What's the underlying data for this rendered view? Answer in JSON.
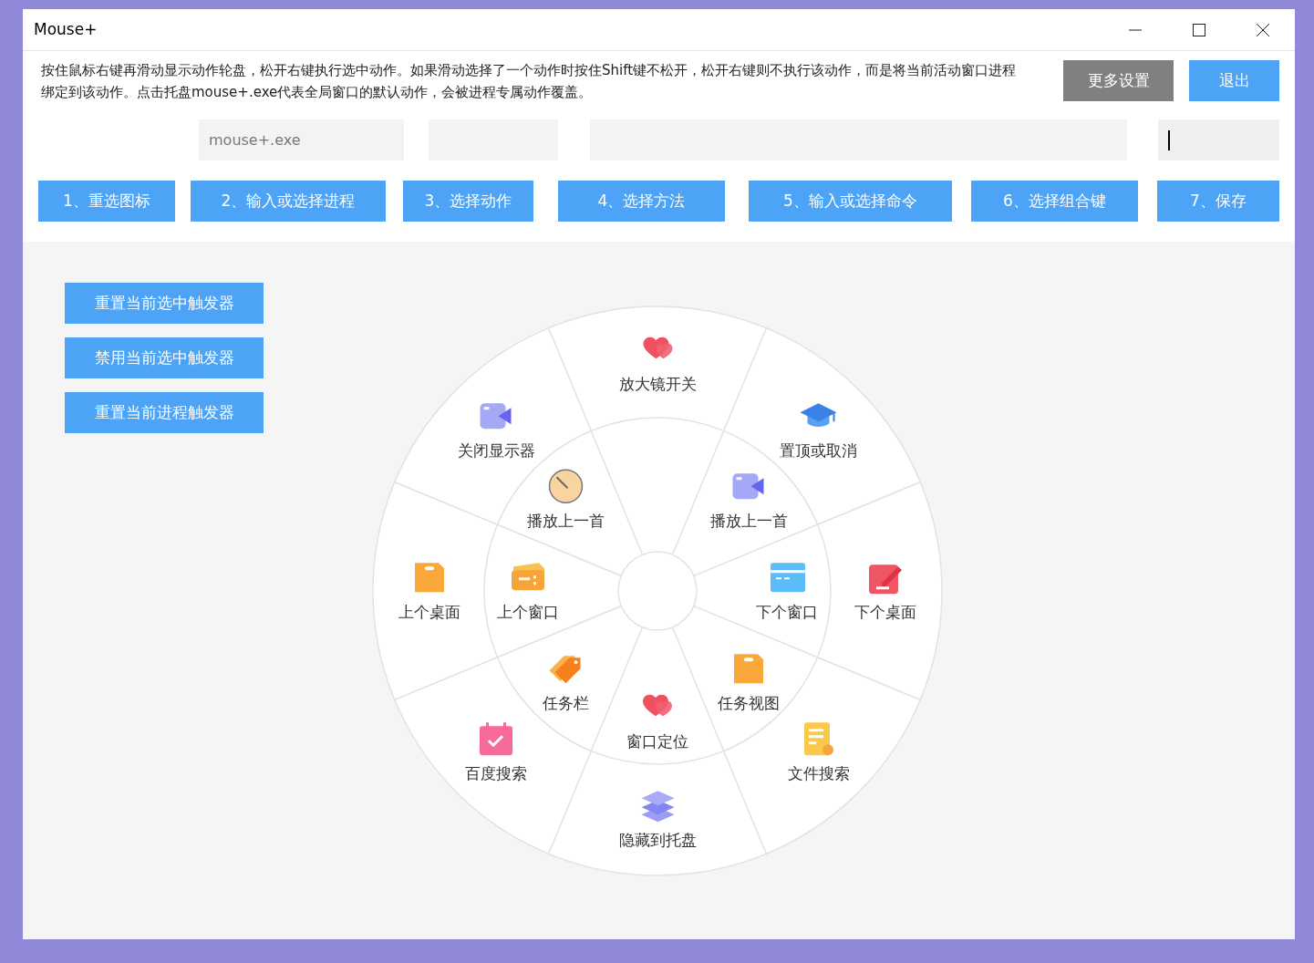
{
  "window": {
    "title": "Mouse+"
  },
  "description": "按住鼠标右键再滑动显示动作轮盘，松开右键执行选中动作。如果滑动选择了一个动作时按住Shift键不松开，松开右键则不执行该动作，而是将当前活动窗口进程绑定到该动作。点击托盘mouse+.exe代表全局窗口的默认动作，会被进程专属动作覆盖。",
  "top_buttons": [
    {
      "label": "更多设置",
      "kind": "secondary"
    },
    {
      "label": "退出",
      "kind": "primary"
    }
  ],
  "fields": [
    {
      "value": "mouse+.exe",
      "focused": false
    },
    {
      "focused": false
    },
    {
      "focused": false
    },
    {
      "focused": true
    }
  ],
  "steps": [
    "1、重选图标",
    "2、输入或选择进程",
    "3、选择动作",
    "4、选择方法",
    "5、输入或选择命令",
    "6、选择组合键",
    "7、保存"
  ],
  "side_buttons": [
    "重置当前选中触发器",
    "禁用当前选中触发器",
    "重置当前进程触发器"
  ],
  "wheel": {
    "outer": [
      {
        "label": "放大镜开关",
        "kind": "heart"
      },
      {
        "label": "置顶或取消",
        "kind": "cap"
      },
      {
        "label": "下个桌面",
        "kind": "edit"
      },
      {
        "label": "文件搜索",
        "kind": "doc"
      },
      {
        "label": "隐藏到托盘",
        "kind": "layers"
      },
      {
        "label": "百度搜索",
        "kind": "calendar"
      },
      {
        "label": "上个桌面",
        "kind": "folder"
      },
      {
        "label": "关闭显示器",
        "kind": "video"
      }
    ],
    "inner": [
      {
        "label": "播放上一首",
        "kind": "video"
      },
      {
        "label": "下个窗口",
        "kind": "card"
      },
      {
        "label": "任务视图",
        "kind": "folder"
      },
      {
        "label": "窗口定位",
        "kind": "heart"
      },
      {
        "label": "任务栏",
        "kind": "tag"
      },
      {
        "label": "上个窗口",
        "kind": "ticket"
      },
      {
        "label": "播放上一首",
        "kind": "clock"
      }
    ]
  }
}
